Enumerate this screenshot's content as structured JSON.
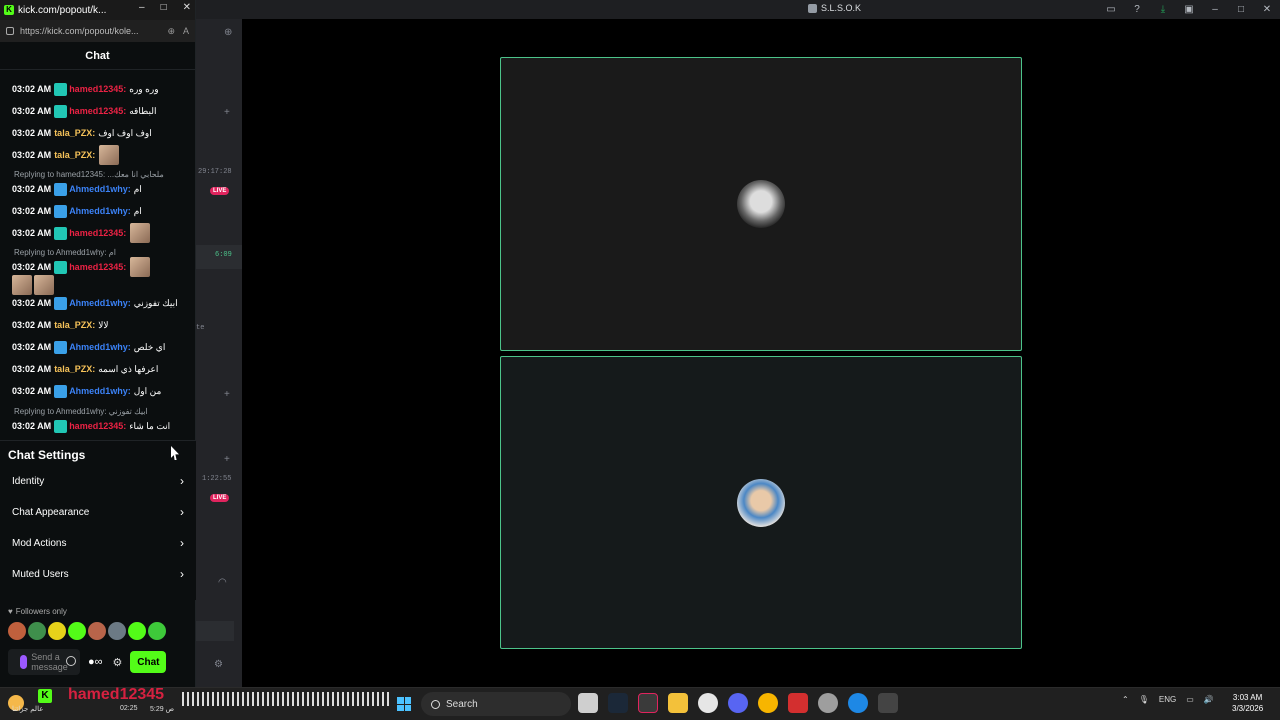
{
  "main_window": {
    "title": "S.L.S.O.K",
    "side_times": [
      "29:17:28",
      "6:09",
      "1:22:55"
    ],
    "live_badge": "LIVE",
    "side_fragment": "te"
  },
  "popout": {
    "title": "kick.com/popout/k...",
    "url": "https://kick.com/popout/kole...",
    "chat_header": "Chat",
    "messages": [
      {
        "time": "03:02 AM",
        "user": "hamed12345",
        "text": "وره وره"
      },
      {
        "time": "03:02 AM",
        "user": "hamed12345",
        "text": "البطاقه"
      },
      {
        "time": "03:02 AM",
        "user": "tala_PZX",
        "text": "اوف اوف اوف"
      },
      {
        "time": "03:02 AM",
        "user": "tala_PZX",
        "text": ""
      },
      {
        "time": "03:02 AM",
        "user": "Ahmedd1why",
        "text": "ام"
      },
      {
        "time": "03:02 AM",
        "user": "Ahmedd1why",
        "text": "ام"
      },
      {
        "time": "03:02 AM",
        "user": "hamed12345",
        "text": ""
      },
      {
        "time": "03:02 AM",
        "user": "hamed12345",
        "text": ""
      },
      {
        "time": "03:02 AM",
        "user": "Ahmedd1why",
        "text": "ابيك تفوزني"
      },
      {
        "time": "03:02 AM",
        "user": "tala_PZX",
        "text": "لالا"
      },
      {
        "time": "03:02 AM",
        "user": "Ahmedd1why",
        "text": "اي خلص"
      },
      {
        "time": "03:02 AM",
        "user": "tala_PZX",
        "text": "اعرفها ذي اسمه"
      },
      {
        "time": "03:02 AM",
        "user": "Ahmedd1why",
        "text": "من اول"
      },
      {
        "time": "03:02 AM",
        "user": "hamed12345",
        "text": "انت ما شاء"
      }
    ],
    "replies": [
      "Replying to hamed12345: ...ملحابي انا معك",
      "Replying to Ahmedd1why: ام",
      "Replying to Ahmedd1why: ابيك تفوزني"
    ],
    "chat_settings": {
      "title": "Chat Settings",
      "items": [
        "Identity",
        "Chat Appearance",
        "Mod Actions",
        "Muted Users"
      ]
    },
    "followers_only": "Followers only",
    "input_placeholder": "Send a message",
    "chat_button": "Chat",
    "points": "∞"
  },
  "taskbar": {
    "overlay_name": "hamed12345",
    "weather_text": "عالم جزائنا",
    "small_time_1": "02:25",
    "small_time_2": "5:29 ص",
    "search_label": "Search",
    "language": "ENG",
    "time": "3:03 AM",
    "date": "3/3/2026"
  }
}
